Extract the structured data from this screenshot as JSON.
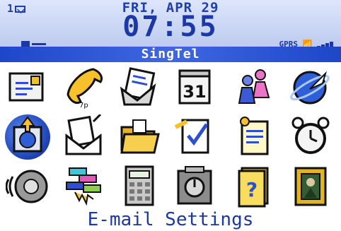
{
  "status": {
    "unread_count": "1",
    "date": "FRI, APR 29",
    "time": "07:55",
    "network_type": "GPRS",
    "carrier": "SingTel"
  },
  "selected_label": "E-mail Settings",
  "icons": [
    {
      "name": "messages-icon"
    },
    {
      "name": "phone-icon"
    },
    {
      "name": "saved-messages-icon"
    },
    {
      "name": "calendar-icon",
      "text": "31"
    },
    {
      "name": "contacts-icon"
    },
    {
      "name": "browser-icon"
    },
    {
      "name": "email-settings-icon"
    },
    {
      "name": "compose-email-icon"
    },
    {
      "name": "folders-icon"
    },
    {
      "name": "tasks-icon"
    },
    {
      "name": "memopad-icon"
    },
    {
      "name": "alarm-icon"
    },
    {
      "name": "profiles-icon"
    },
    {
      "name": "brickbreaker-icon"
    },
    {
      "name": "calculator-icon"
    },
    {
      "name": "security-icon"
    },
    {
      "name": "help-icon",
      "text": "?"
    },
    {
      "name": "picture-icon"
    }
  ],
  "colors": {
    "accent": "#1b38a6",
    "carrier_bar": "#1d47c9",
    "header_bg": "#c6d2f2"
  }
}
